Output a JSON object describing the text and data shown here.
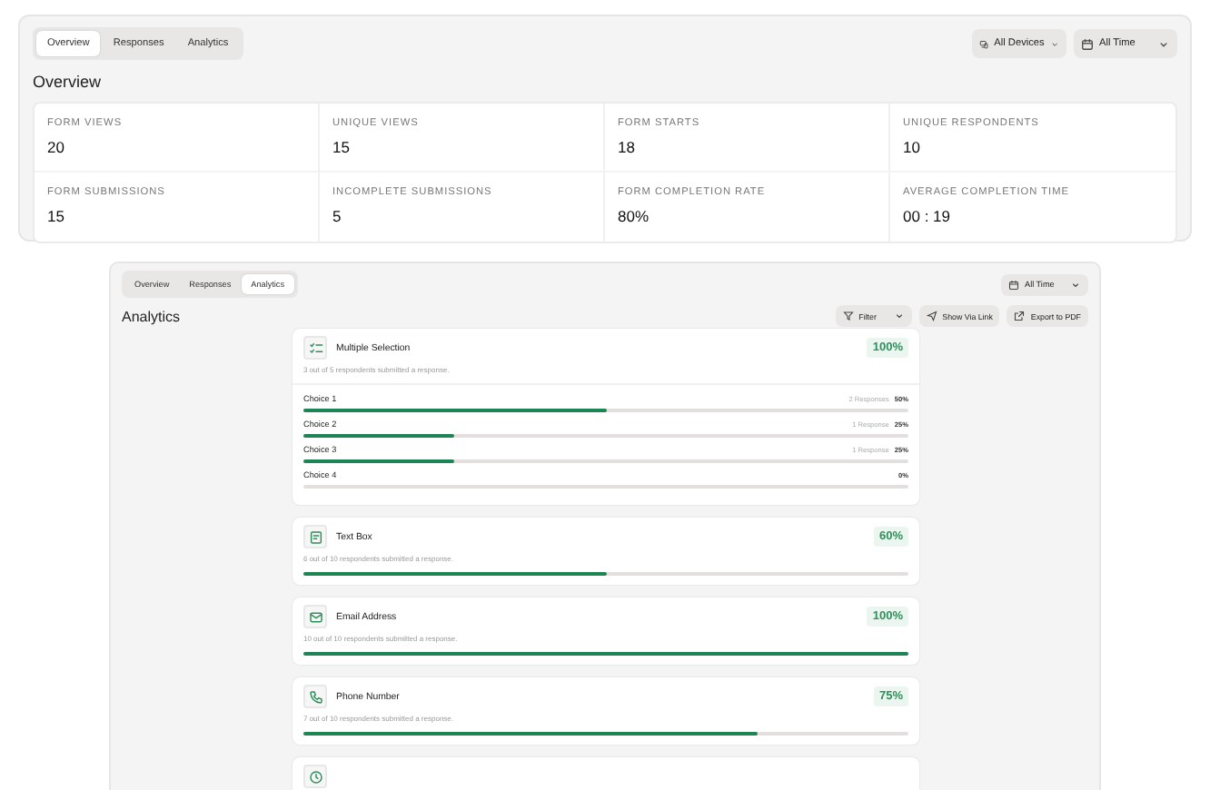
{
  "overview": {
    "tabs": [
      {
        "label": "Overview",
        "selected": true
      },
      {
        "label": "Responses",
        "selected": false
      },
      {
        "label": "Analytics",
        "selected": false
      }
    ],
    "filters": [
      {
        "kind": "devices",
        "label": "All Devices"
      },
      {
        "kind": "calendar",
        "label": "All Time"
      }
    ],
    "title": "Overview",
    "stats": [
      {
        "label": "FORM VIEWS",
        "value": "20"
      },
      {
        "label": "UNIQUE VIEWS",
        "value": "15"
      },
      {
        "label": "FORM STARTS",
        "value": "18"
      },
      {
        "label": "UNIQUE RESPONDENTS",
        "value": "10"
      },
      {
        "label": "FORM SUBMISSIONS",
        "value": "15"
      },
      {
        "label": "INCOMPLETE SUBMISSIONS",
        "value": "5"
      },
      {
        "label": "FORM COMPLETION RATE",
        "value": "80%"
      },
      {
        "label": "AVERAGE COMPLETION TIME",
        "value": "00 : 19"
      }
    ]
  },
  "analytics": {
    "tabs": [
      {
        "label": "Overview",
        "selected": false
      },
      {
        "label": "Responses",
        "selected": false
      },
      {
        "label": "Analytics",
        "selected": true
      }
    ],
    "time_filter": {
      "kind": "calendar",
      "label": "All Time"
    },
    "title": "Analytics",
    "actions": [
      {
        "kind": "filter",
        "label": "Filter"
      },
      {
        "kind": "share",
        "label": "Show Via Link"
      },
      {
        "kind": "export",
        "label": "Export to PDF"
      }
    ],
    "questions": [
      {
        "kind": "multiple",
        "title": "Multiple Selection",
        "percent": "100%",
        "summary": "3 out of 5 respondents submitted a response.",
        "choices": [
          {
            "label": "Choice 1",
            "responses": "2 Responses",
            "percent": "50%",
            "level": 0.5
          },
          {
            "label": "Choice 2",
            "responses": "1 Response",
            "percent": "25%",
            "level": 0.25
          },
          {
            "label": "Choice 3",
            "responses": "1 Response",
            "percent": "25%",
            "level": 0.25
          },
          {
            "label": "Choice 4",
            "percent": "0%",
            "level": 0
          }
        ]
      },
      {
        "kind": "text",
        "title": "Text Box",
        "percent": "60%",
        "summary": "6 out of 10 respondents submitted a response.",
        "level": 0.5
      },
      {
        "kind": "email",
        "title": "Email Address",
        "percent": "100%",
        "summary": "10 out of 10 respondents submitted a response.",
        "level": 1
      },
      {
        "kind": "phone",
        "title": "Phone Number",
        "percent": "75%",
        "summary": "7 out of 10 respondents submitted a response.",
        "level": 0.75
      },
      {
        "kind": "date"
      }
    ]
  }
}
